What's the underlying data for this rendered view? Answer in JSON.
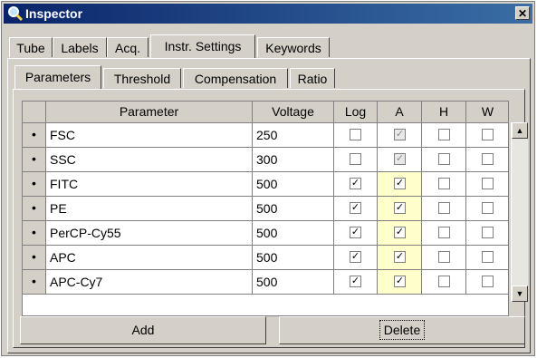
{
  "window": {
    "title": "Inspector",
    "close_label": "✕"
  },
  "tabs": [
    {
      "label": "Tube"
    },
    {
      "label": "Labels"
    },
    {
      "label": "Acq."
    },
    {
      "label": "Instr. Settings"
    },
    {
      "label": "Keywords"
    }
  ],
  "active_tab": "Instr. Settings",
  "subtabs": [
    {
      "label": "Parameters"
    },
    {
      "label": "Threshold"
    },
    {
      "label": "Compensation"
    },
    {
      "label": "Ratio"
    }
  ],
  "active_subtab": "Parameters",
  "table": {
    "columns": [
      "Parameter",
      "Voltage",
      "Log",
      "A",
      "H",
      "W"
    ],
    "rows": [
      {
        "marker": "•",
        "parameter": "FSC",
        "voltage": "250",
        "log": false,
        "a": true,
        "h": false,
        "w": false,
        "log_enabled": true,
        "a_enabled": false
      },
      {
        "marker": "•",
        "parameter": "SSC",
        "voltage": "300",
        "log": false,
        "a": true,
        "h": false,
        "w": false,
        "log_enabled": true,
        "a_enabled": false
      },
      {
        "marker": "•",
        "parameter": "FITC",
        "voltage": "500",
        "log": true,
        "a": true,
        "h": false,
        "w": false,
        "log_enabled": true,
        "a_enabled": true
      },
      {
        "marker": "•",
        "parameter": "PE",
        "voltage": "500",
        "log": true,
        "a": true,
        "h": false,
        "w": false,
        "log_enabled": true,
        "a_enabled": true
      },
      {
        "marker": "•",
        "parameter": "PerCP-Cy55",
        "voltage": "500",
        "log": true,
        "a": true,
        "h": false,
        "w": false,
        "log_enabled": true,
        "a_enabled": true
      },
      {
        "marker": "•",
        "parameter": "APC",
        "voltage": "500",
        "log": true,
        "a": true,
        "h": false,
        "w": false,
        "log_enabled": true,
        "a_enabled": true
      },
      {
        "marker": "•",
        "parameter": "APC-Cy7",
        "voltage": "500",
        "log": true,
        "a": true,
        "h": false,
        "w": false,
        "log_enabled": true,
        "a_enabled": true
      }
    ]
  },
  "buttons": {
    "add": "Add",
    "delete": "Delete"
  },
  "colors": {
    "title_start": "#0a246a",
    "title_end": "#3a6ea5",
    "face": "#d4d0c8",
    "highlight_column": "#ffffcc"
  },
  "icons": {
    "window": "magnifier-icon",
    "close": "close-icon",
    "scroll_up": "arrow-up-icon",
    "scroll_down": "arrow-down-icon"
  }
}
